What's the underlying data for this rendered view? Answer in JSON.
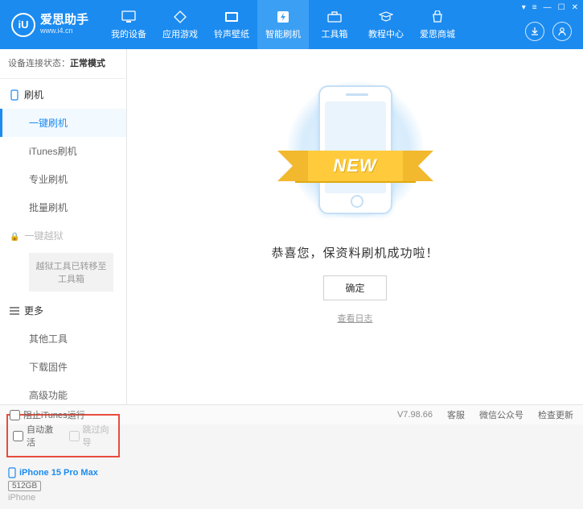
{
  "app": {
    "name": "爱思助手",
    "url": "www.i4.cn",
    "logo_glyph": "iU"
  },
  "nav": {
    "items": [
      {
        "label": "我的设备"
      },
      {
        "label": "应用游戏"
      },
      {
        "label": "铃声壁纸"
      },
      {
        "label": "智能刷机"
      },
      {
        "label": "工具箱"
      },
      {
        "label": "教程中心"
      },
      {
        "label": "爱思商城"
      }
    ],
    "active_index": 3
  },
  "status": {
    "prefix": "设备连接状态：",
    "value": "正常模式"
  },
  "sidebar": {
    "group_flash": "刷机",
    "items_flash": [
      "一键刷机",
      "iTunes刷机",
      "专业刷机",
      "批量刷机"
    ],
    "active_flash_index": 0,
    "group_jailbreak": "一键越狱",
    "jailbreak_note": "越狱工具已转移至工具箱",
    "group_more": "更多",
    "items_more": [
      "其他工具",
      "下载固件",
      "高级功能"
    ],
    "checkbox_auto_activate": "自动激活",
    "checkbox_skip_guide": "跳过向导"
  },
  "device": {
    "name": "iPhone 15 Pro Max",
    "storage": "512GB",
    "type": "iPhone"
  },
  "main": {
    "ribbon": "NEW",
    "success_text": "恭喜您，保资料刷机成功啦！",
    "confirm": "确定",
    "view_log": "查看日志"
  },
  "footer": {
    "block_itunes": "阻止iTunes运行",
    "version": "V7.98.66",
    "links": [
      "客服",
      "微信公众号",
      "检查更新"
    ]
  }
}
